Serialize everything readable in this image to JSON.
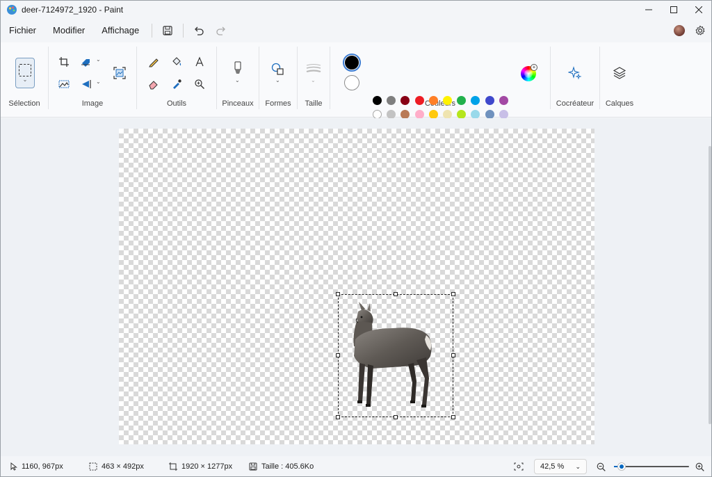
{
  "window": {
    "title": "deer-7124972_1920 - Paint"
  },
  "menu": {
    "file": "Fichier",
    "edit": "Modifier",
    "view": "Affichage"
  },
  "ribbon": {
    "selection": "Sélection",
    "image": "Image",
    "tools": "Outils",
    "brushes": "Pinceaux",
    "shapes": "Formes",
    "size": "Taille",
    "colors": "Couleurs",
    "cocreator": "Cocréateur",
    "layers": "Calques"
  },
  "colors": {
    "primary": "#000000",
    "secondary": "#ffffff",
    "row1": [
      "#000000",
      "#7f7f7f",
      "#880015",
      "#ed1c24",
      "#ff7f27",
      "#fff200",
      "#22b14c",
      "#00a2e8",
      "#3f48cc",
      "#a349a4"
    ],
    "row2": [
      "#ffffff",
      "#c3c3c3",
      "#b97a57",
      "#ffaec9",
      "#ffc90e",
      "#efe4b0",
      "#b5e61d",
      "#99d9ea",
      "#7092be",
      "#c8bfe7"
    ]
  },
  "status": {
    "cursor": "1160, 967px",
    "selection_size": "463 × 492px",
    "image_size": "1920 × 1277px",
    "file_size": "Taille : 405.6Ko",
    "zoom": "42,5 %",
    "zoom_level_percent": 10
  }
}
